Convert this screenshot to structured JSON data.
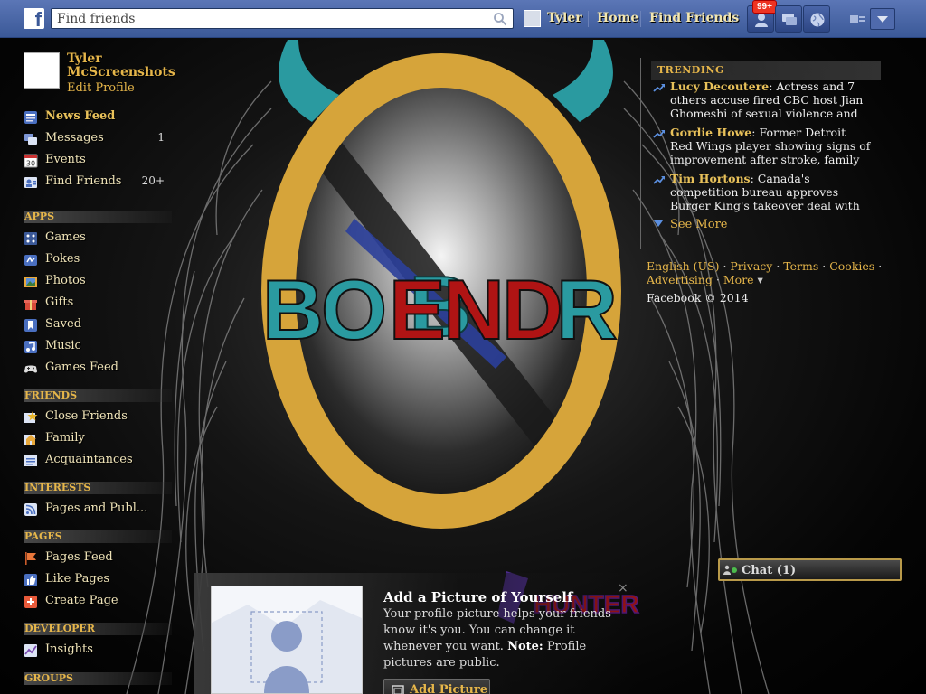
{
  "topbar": {
    "search_placeholder": "Find friends",
    "user_name": "Tyler",
    "home_label": "Home",
    "find_friends_label": "Find Friends",
    "notification_badge": "99+"
  },
  "profile": {
    "name": "Tyler McScreenshots",
    "edit_label": "Edit Profile"
  },
  "nav": {
    "main": [
      {
        "label": "News Feed",
        "icon": "news-feed-icon",
        "count": ""
      },
      {
        "label": "Messages",
        "icon": "messages-icon",
        "count": "1"
      },
      {
        "label": "Events",
        "icon": "calendar-icon",
        "count": ""
      },
      {
        "label": "Find Friends",
        "icon": "find-friends-icon",
        "count": "20+"
      }
    ],
    "apps_heading": "APPS",
    "apps": [
      {
        "label": "Games",
        "icon": "games-icon"
      },
      {
        "label": "Pokes",
        "icon": "pokes-icon"
      },
      {
        "label": "Photos",
        "icon": "photos-icon"
      },
      {
        "label": "Gifts",
        "icon": "gift-icon"
      },
      {
        "label": "Saved",
        "icon": "bookmark-icon"
      },
      {
        "label": "Music",
        "icon": "music-icon"
      },
      {
        "label": "Games Feed",
        "icon": "gamepad-icon"
      }
    ],
    "friends_heading": "FRIENDS",
    "friends": [
      {
        "label": "Close Friends",
        "icon": "star-icon"
      },
      {
        "label": "Family",
        "icon": "family-icon"
      },
      {
        "label": "Acquaintances",
        "icon": "acquaintances-icon"
      }
    ],
    "interests_heading": "INTERESTS",
    "interests": [
      {
        "label": "Pages and Publ...",
        "icon": "rss-icon"
      }
    ],
    "pages_heading": "PAGES",
    "pages": [
      {
        "label": "Pages Feed",
        "icon": "flag-icon"
      },
      {
        "label": "Like Pages",
        "icon": "thumbs-up-icon"
      },
      {
        "label": "Create Page",
        "icon": "plus-icon"
      }
    ],
    "developer_heading": "DEVELOPER",
    "developer": [
      {
        "label": "Insights",
        "icon": "chart-icon"
      }
    ],
    "groups_heading": "GROUPS"
  },
  "trending": {
    "heading": "TRENDING",
    "items": [
      {
        "name": "Lucy Decoutere",
        "text": ": Actress and 7 others accuse fired CBC host Jian Ghomeshi of sexual violence and"
      },
      {
        "name": "Gordie Howe",
        "text": ": Former Detroit Red Wings player showing signs of improvement after stroke, family"
      },
      {
        "name": "Tim Hortons",
        "text": ": Canada's competition bureau approves Burger King's takeover deal with"
      }
    ],
    "see_more": "See More"
  },
  "footer": {
    "links": [
      "English (US)",
      "Privacy",
      "Terms",
      "Cookies",
      "Advertising",
      "More"
    ],
    "copyright": "Facebook © 2014"
  },
  "prompt": {
    "title": "Add a Picture of Yourself",
    "desc": "Your profile picture helps your friends know it's you. You can change it whenever you want.",
    "note_label": "Note:",
    "note_text": "Profile pictures are public.",
    "button": "Add Picture",
    "close": "×"
  },
  "chat": {
    "label": "Chat (1)"
  },
  "theme": {
    "bar_blue": "#3b5998",
    "gold": "#e6b64a",
    "logo_ring": "#d6a43a",
    "logo_teal": "#2a9aa0",
    "logo_red": "#b01414"
  }
}
